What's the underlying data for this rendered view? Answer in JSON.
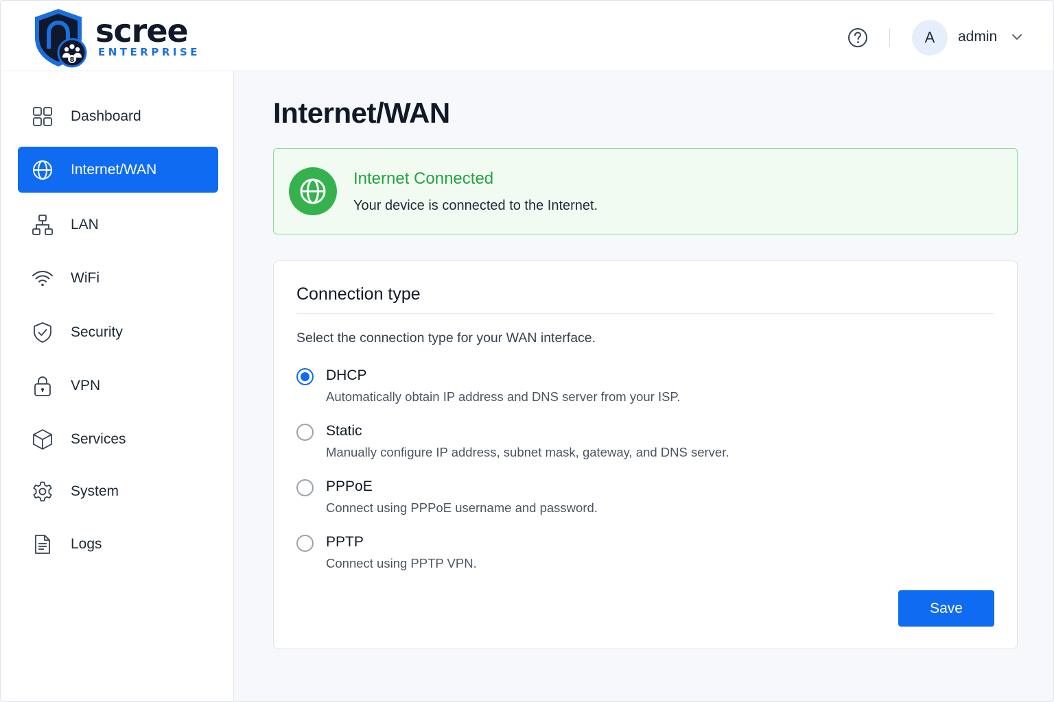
{
  "brand": {
    "name": "scree",
    "subtitle": "ENTERPRISE",
    "badge_number": "8",
    "colors": {
      "navy": "#10182b",
      "blue": "#1a6fe0"
    }
  },
  "header": {
    "help_icon": "question-circle-icon",
    "user": {
      "initial": "A",
      "name": "admin",
      "chevron_icon": "chevron-down-icon"
    }
  },
  "sidebar": {
    "items": [
      {
        "label": "Dashboard",
        "icon": "grid-icon",
        "active": false
      },
      {
        "label": "Internet/WAN",
        "icon": "globe-icon",
        "active": true
      },
      {
        "label": "LAN",
        "icon": "network-icon",
        "active": false
      },
      {
        "label": "WiFi",
        "icon": "wifi-icon",
        "active": false
      },
      {
        "label": "Security",
        "icon": "shield-check-icon",
        "active": false
      },
      {
        "label": "VPN",
        "icon": "lock-icon",
        "active": false
      },
      {
        "label": "Services",
        "icon": "cube-icon",
        "active": false
      },
      {
        "label": "System",
        "icon": "gear-icon",
        "active": false
      },
      {
        "label": "Logs",
        "icon": "document-icon",
        "active": false
      }
    ]
  },
  "main": {
    "title": "Internet/WAN",
    "status": {
      "title": "Internet Connected",
      "text": "Your device is connected to the Internet.",
      "icon": "globe-icon"
    },
    "connection": {
      "title": "Connection type",
      "description": "Select the connection type for your WAN interface.",
      "selected": "DHCP",
      "options": [
        {
          "label": "DHCP",
          "description": "Automatically obtain IP address and DNS server from your ISP.",
          "checked": true
        },
        {
          "label": "Static",
          "description": "Manually configure IP address, subnet mask, gateway, and DNS server.",
          "checked": false
        },
        {
          "label": "PPPoE",
          "description": "Connect using PPPoE username and password.",
          "checked": false
        },
        {
          "label": "PPTP",
          "description": "Connect using PPTP VPN.",
          "checked": false
        }
      ],
      "save_label": "Save"
    }
  },
  "colors": {
    "primary": "#0f6cf2",
    "success": "#23a33d",
    "success_bg": "#f1fbf2",
    "success_border": "#8ed99a"
  }
}
